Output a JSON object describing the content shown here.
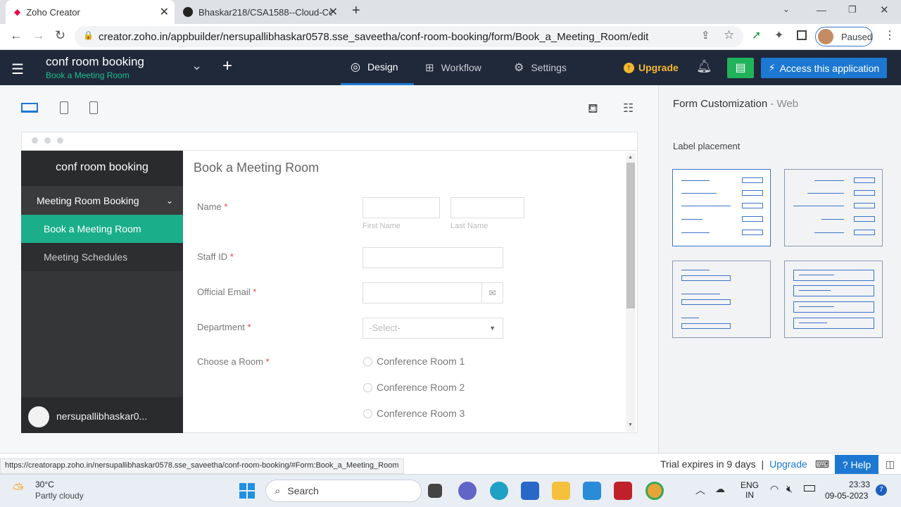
{
  "browser": {
    "tabs": [
      {
        "title": "Zoho Creator",
        "active": true
      },
      {
        "title": "Bhaskar218/CSA1588--Cloud-Co",
        "active": false
      }
    ],
    "url": "creator.zoho.in/appbuilder/nersupallibhaskar0578.sse_saveetha/conf-room-booking/form/Book_a_Meeting_Room/edit",
    "profile_status": "Paused"
  },
  "app": {
    "name": "conf room booking",
    "current_form": "Book a Meeting Room",
    "nav": {
      "design": "Design",
      "workflow": "Workflow",
      "settings": "Settings"
    },
    "upgrade": "Upgrade",
    "access_button": "Access this application"
  },
  "preview": {
    "sidebar": {
      "app_name": "conf room booking",
      "section": "Meeting Room Booking",
      "items": [
        "Book a Meeting Room",
        "Meeting Schedules"
      ],
      "user": "nersupallibhaskar0..."
    },
    "form": {
      "title": "Book a Meeting Room",
      "fields": {
        "name": "Name",
        "first_name_hint": "First Name",
        "last_name_hint": "Last Name",
        "staff_id": "Staff ID",
        "email": "Official Email",
        "department": "Department",
        "department_placeholder": "-Select-",
        "room": "Choose a Room",
        "rooms": [
          "Conference Room 1",
          "Conference Room 2",
          "Conference Room 3"
        ]
      },
      "required_mark": "*"
    }
  },
  "right_panel": {
    "title": "Form Customization",
    "title_suffix": "- Web",
    "label_placement": "Label placement"
  },
  "status": {
    "link_url": "https://creatorapp.zoho.in/nersupallibhaskar0578.sse_saveetha/conf-room-booking/#Form:Book_a_Meeting_Room",
    "trial": "Trial expires in 9 days",
    "separator": "|",
    "upgrade": "Upgrade",
    "help": "Help"
  },
  "taskbar": {
    "weather_temp": "30°C",
    "weather_desc": "Partly cloudy",
    "search": "Search",
    "lang1": "ENG",
    "lang2": "IN",
    "time": "23:33",
    "date": "09-05-2023",
    "notif_count": "7"
  },
  "colors": {
    "header": "#20293a",
    "accent_green": "#1aae8a",
    "primary_blue": "#1d78d2"
  }
}
